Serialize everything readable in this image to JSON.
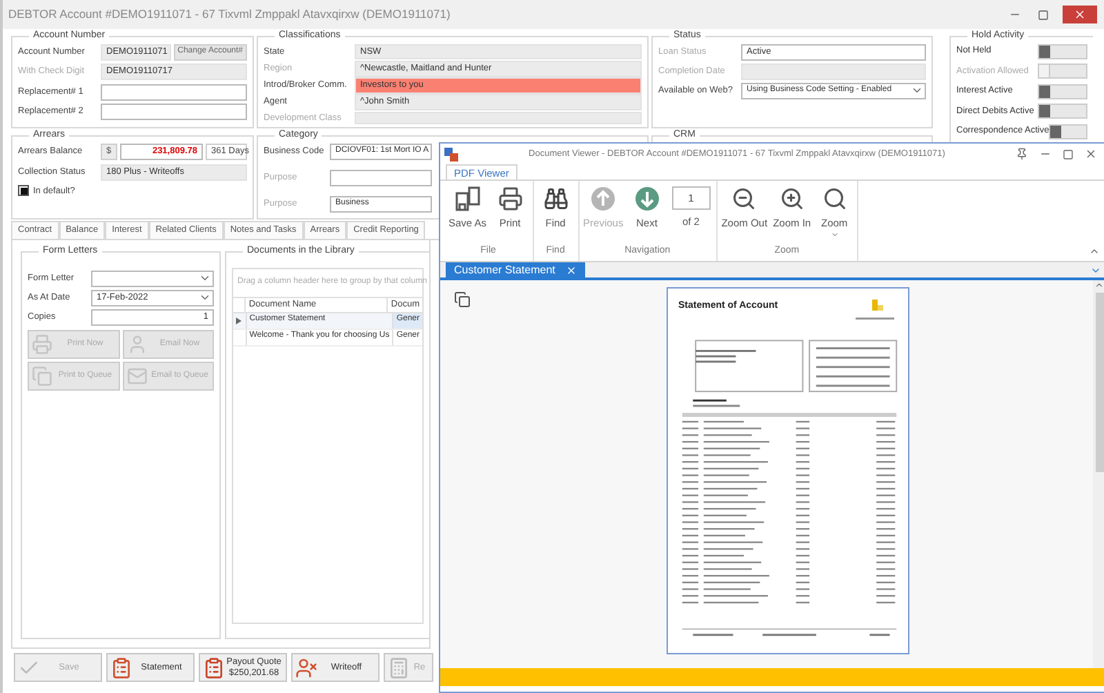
{
  "window": {
    "title": "DEBTOR Account #DEMO1911071 - 67 Tixvml Zmppakl Atavxqirxw (DEMO1911071)"
  },
  "account": {
    "title": "Account Number",
    "fields": [
      {
        "label": "Account Number",
        "value": "DEMO1911071",
        "dim": false,
        "locked": true,
        "button": "Change Account#"
      },
      {
        "label": "With Check Digit",
        "value": "DEMO19110717",
        "dim": true,
        "locked": true
      },
      {
        "label": "Replacement# 1",
        "dim": false,
        "locked": false
      },
      {
        "label": "Replacement# 2",
        "dim": false,
        "locked": false
      }
    ]
  },
  "classifications": {
    "title": "Classifications",
    "fields": [
      {
        "label": "State",
        "value": "NSW",
        "dim": false,
        "locked": true
      },
      {
        "label": "Region",
        "value": "^Newcastle, Maitland and Hunter",
        "dim": true,
        "locked": true
      },
      {
        "label": "Introd/Broker Comm.",
        "value": "Investors to you",
        "dim": false,
        "locked": true,
        "color": "#fa8072"
      },
      {
        "label": "Agent",
        "value": "^John Smith",
        "dim": false,
        "locked": true
      },
      {
        "label": "Development Class",
        "dim": true,
        "locked": true
      }
    ]
  },
  "status": {
    "title": "Status",
    "fields": [
      {
        "label": "Loan Status",
        "value": "Active",
        "dim": true,
        "locked": false
      },
      {
        "label": "Completion Date",
        "dim": true,
        "locked": true
      },
      {
        "label": "Available on Web?",
        "value": "Using Business Code Setting - Enabled",
        "dim": false,
        "locked": false,
        "dropdown": true
      }
    ]
  },
  "hold_activity": {
    "title": "Hold Activity",
    "toggles": [
      {
        "label": "Not Held",
        "disabled": false
      },
      {
        "label": "Activation Allowed",
        "disabled": true
      },
      {
        "label": "Interest Active",
        "disabled": false
      },
      {
        "label": "Direct Debits Active",
        "disabled": false
      },
      {
        "label": "Correspondence Active",
        "disabled": false
      }
    ]
  },
  "arrears": {
    "title": "Arrears",
    "fields": [
      {
        "label": "Arrears Balance",
        "prefix": "$",
        "value": "231,809.78",
        "extra": "361 Days",
        "alert": true,
        "dim": false,
        "locked": false
      },
      {
        "label": "Collection Status",
        "value": "180 Plus - Writeoffs",
        "dim": false,
        "locked": true
      }
    ],
    "checkbox": {
      "label": "In default?",
      "checked": true
    }
  },
  "category": {
    "title": "Category",
    "fields": [
      {
        "label": "Business Code",
        "value": "DCIOVF01: 1st Mort IO A",
        "dim": false,
        "locked": false
      },
      {
        "label": "Purpose",
        "dim": true,
        "locked": false
      },
      {
        "label": "Purpose",
        "value": "Business",
        "dim": true,
        "locked": false
      }
    ]
  },
  "crm": {
    "title": "CRM"
  },
  "tabs": [
    {
      "label": "Contract",
      "selected": false
    },
    {
      "label": "Balance",
      "selected": false
    },
    {
      "label": "Interest",
      "selected": false
    },
    {
      "label": "Related Clients",
      "selected": false
    },
    {
      "label": "Notes and Tasks",
      "selected": false
    },
    {
      "label": "Arrears",
      "selected": false
    },
    {
      "label": "Credit Reporting",
      "selected": false
    }
  ],
  "form_letters": {
    "title": "Form Letters",
    "fields": [
      {
        "label": "Form Letter",
        "dim": false,
        "locked": false,
        "dropdown": true
      },
      {
        "label": "As At Date",
        "value": "17-Feb-2022",
        "dim": false,
        "locked": false,
        "dropdown": true
      },
      {
        "label": "Copies",
        "value": "1",
        "dim": false,
        "locked": false,
        "numeric": true
      }
    ],
    "buttons": [
      {
        "kind": "print",
        "label": "Print Now",
        "disabled": true
      },
      {
        "kind": "email",
        "label": "Email Now",
        "disabled": true
      },
      {
        "kind": "print-queue",
        "label": "Print to Queue",
        "disabled": true
      },
      {
        "kind": "email-queue",
        "label": "Email to Queue",
        "disabled": true
      }
    ]
  },
  "library": {
    "title": "Documents in the Library",
    "hint": "Drag a column header here to group by that column",
    "columns": [
      "Document Name",
      "Docum"
    ],
    "rows": [
      {
        "cells": [
          "Customer Statement",
          "Gener"
        ],
        "selected": true
      },
      {
        "cells": [
          "Welcome - Thank you for choosing Us",
          "Gener"
        ],
        "selected": false
      }
    ]
  },
  "actions": [
    {
      "kind": "save",
      "label": "Save",
      "disabled": true
    },
    {
      "kind": "statement",
      "label": "Statement",
      "disabled": false
    },
    {
      "kind": "payout",
      "label": "Payout Quote",
      "sublabel": "$250,201.68",
      "disabled": false
    },
    {
      "kind": "writeoff",
      "label": "Writeoff",
      "disabled": false
    },
    {
      "kind": "calculator",
      "label": "Re",
      "disabled": true
    }
  ],
  "viewer": {
    "title": "Document Viewer - DEBTOR Account #DEMO1911071 - 67 Tixvml Zmppakl Atavxqirxw (DEMO1911071)",
    "ribbon_tabs": [
      {
        "label": "PDF Viewer",
        "selected": true
      }
    ],
    "groups": [
      {
        "label": "File",
        "items": [
          {
            "kind": "save",
            "label": "Save As",
            "disabled": false
          },
          {
            "kind": "print",
            "label": "Print",
            "disabled": false
          }
        ]
      },
      {
        "label": "Find",
        "items": [
          {
            "kind": "find",
            "label": "Find",
            "disabled": false
          }
        ]
      },
      {
        "label": "Navigation",
        "items": [
          {
            "kind": "previous",
            "label": "Previous",
            "disabled": true
          },
          {
            "kind": "next",
            "label": "Next",
            "disabled": false
          },
          {
            "kind": "page",
            "value": "1",
            "label": "of 2",
            "disabled": false
          }
        ]
      },
      {
        "label": "Zoom",
        "items": [
          {
            "kind": "zoom-out",
            "label": "Zoom Out",
            "disabled": false
          },
          {
            "kind": "zoom-in",
            "label": "Zoom In",
            "disabled": false
          },
          {
            "kind": "zoom",
            "label": "Zoom",
            "disabled": false
          }
        ]
      }
    ],
    "doc_tabs": [
      {
        "label": "Customer Statement",
        "selected": true
      }
    ],
    "page_title": "Statement of Account"
  }
}
